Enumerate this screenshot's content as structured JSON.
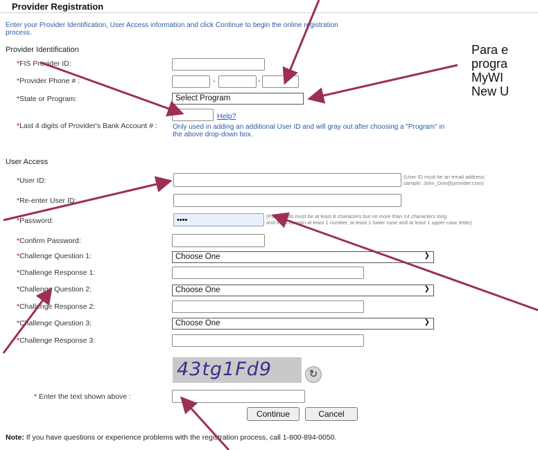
{
  "page": {
    "title": "Provider Registration",
    "intro": "Enter your Provider Identification, User Access information and click Continue to begin the online registration process."
  },
  "provider_identification": {
    "section_label": "Provider Identification",
    "fis_label": "FIS Provider ID:",
    "phone_label": "Provider Phone # :",
    "state_label": "State or Program:",
    "state_selected": "Select Program",
    "bank_label": "Last 4 digits of Provider's Bank Account # :",
    "help_link": "Help?",
    "bank_note": "Only used in adding an additional User ID and will gray out after choosing a \"Program\" in the above drop-down box.",
    "phone_dash": "-"
  },
  "user_access": {
    "section_label": "User Access",
    "userid_label": "User ID:",
    "userid_hint_1": "(User ID must be an email address;",
    "userid_hint_2": "sample: John_Doe@provider.com)",
    "reenter_label": "Re-enter User ID:",
    "password_label": "Password:",
    "password_value": "••••",
    "password_hint_1": "(Passwords must be at least 8 characters but no more than 14 characters long",
    "password_hint_2": "and must contain at least 1 number, at least 1 lower case and at least 1 upper case letter)",
    "confirm_label": "Confirm Password:",
    "q1_label": "Challenge Question 1:",
    "r1_label": "Challenge Response 1:",
    "q2_label": "Challenge Question 2:",
    "r2_label": "Challenge Response 2:",
    "q3_label": "Challenge Question 3:",
    "r3_label": "Challenge Response 3:",
    "choose_one": "Choose One"
  },
  "captcha": {
    "image_text": "43tg1Fd9",
    "label": "Enter the text shown above :"
  },
  "buttons": {
    "continue": "Continue",
    "cancel": "Cancel"
  },
  "footer": {
    "note_bold": "Note:",
    "note_text": " If you have questions or experience problems with the registration process, call 1-800-894-0050."
  },
  "side_annotation": {
    "line1": "Para e",
    "line2": "progra",
    "line3": "MyWI",
    "line4": "New U"
  },
  "colors": {
    "arrow": "#9c2f56",
    "link_blue": "#2f5aa8",
    "required": "#c00000"
  },
  "icons": {
    "refresh": "refresh-icon",
    "dropdown": "chevron-down-icon"
  }
}
